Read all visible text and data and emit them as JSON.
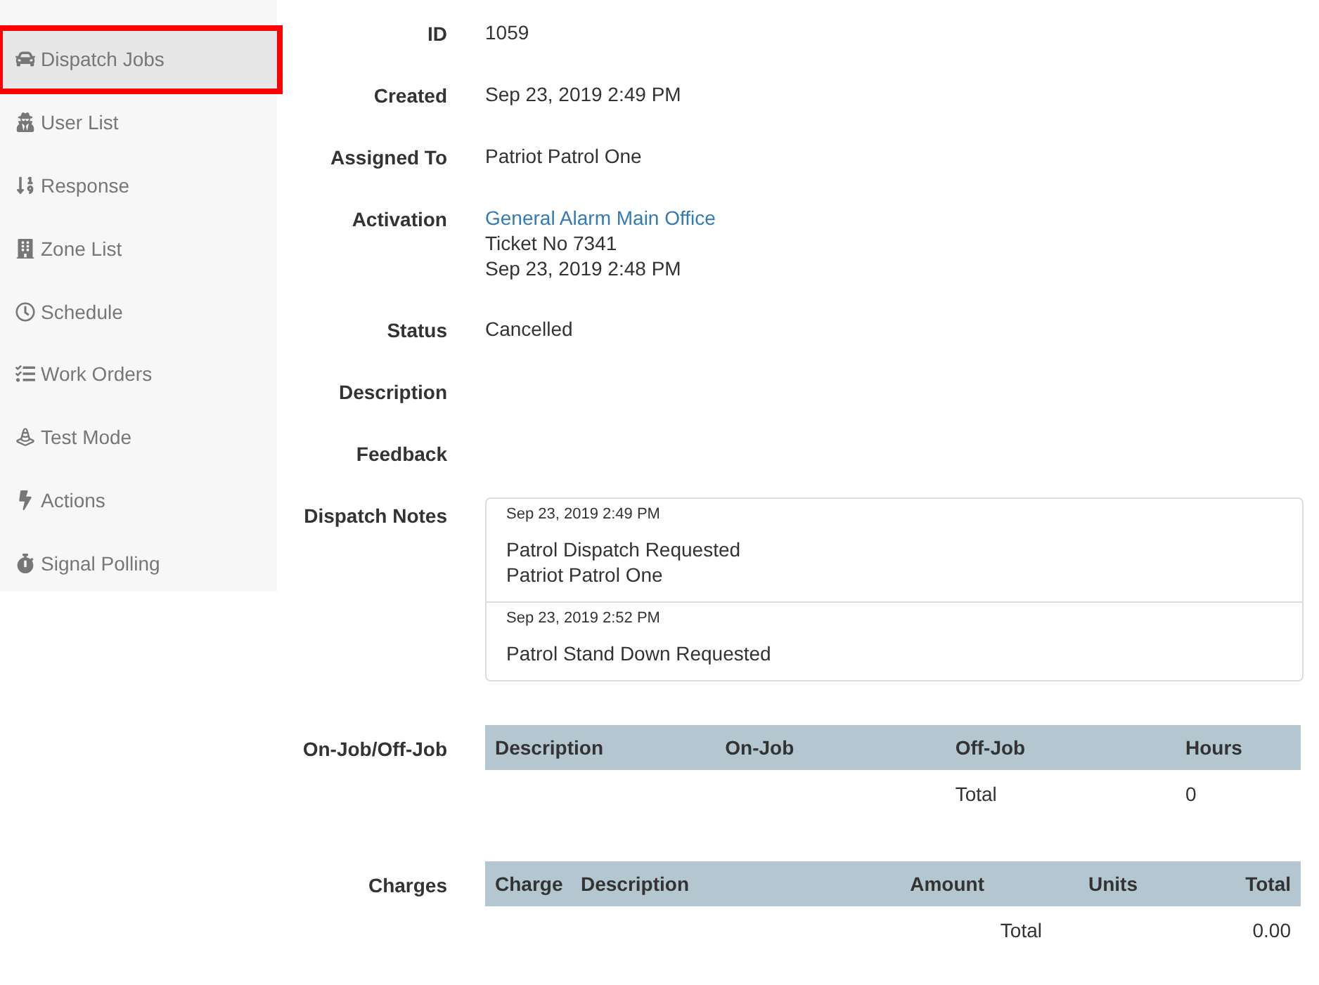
{
  "sidebar": {
    "items": [
      {
        "label": "Dispatch Jobs",
        "selected": true,
        "outlined": true
      },
      {
        "label": "User List",
        "selected": false,
        "outlined": false
      },
      {
        "label": "Response",
        "selected": false,
        "outlined": false
      },
      {
        "label": "Zone List",
        "selected": false,
        "outlined": false
      },
      {
        "label": "Schedule",
        "selected": false,
        "outlined": false
      },
      {
        "label": "Work Orders",
        "selected": false,
        "outlined": false
      },
      {
        "label": "Test Mode",
        "selected": false,
        "outlined": false
      },
      {
        "label": "Actions",
        "selected": false,
        "outlined": false
      },
      {
        "label": "Signal Polling",
        "selected": false,
        "outlined": false
      }
    ]
  },
  "details": [
    {
      "kind": "text",
      "label": "ID",
      "lines": [
        "1059"
      ]
    },
    {
      "kind": "text",
      "label": "Created",
      "lines": [
        "Sep 23, 2019 2:49 PM"
      ]
    },
    {
      "kind": "text",
      "label": "Assigned To",
      "lines": [
        "Patriot Patrol One"
      ]
    },
    {
      "kind": "activation",
      "label": "Activation",
      "link": "General Alarm Main Office",
      "lines": [
        "Ticket No 7341",
        "Sep 23, 2019 2:48 PM"
      ]
    },
    {
      "kind": "text",
      "label": "Status",
      "lines": [
        "Cancelled"
      ]
    },
    {
      "kind": "text",
      "label": "Description"
    },
    {
      "kind": "text",
      "label": "Feedback"
    }
  ],
  "dispatch_notes": {
    "label": "Dispatch Notes",
    "notes": [
      {
        "time": "Sep 23, 2019 2:49 PM",
        "lines": [
          "Patrol Dispatch Requested",
          "Patriot Patrol One"
        ]
      },
      {
        "time": "Sep 23, 2019 2:52 PM",
        "lines": [
          "Patrol Stand Down Requested"
        ]
      }
    ]
  },
  "on_off_job": {
    "label": "On-Job/Off-Job",
    "columns": [
      "Description",
      "On-Job",
      "Off-Job",
      "Hours"
    ],
    "total_label": "Total",
    "total": "0"
  },
  "charges": {
    "label": "Charges",
    "columns": [
      "Charge",
      "Description",
      "Amount",
      "Units",
      "Total"
    ],
    "total_label": "Total",
    "total": "0.00"
  }
}
